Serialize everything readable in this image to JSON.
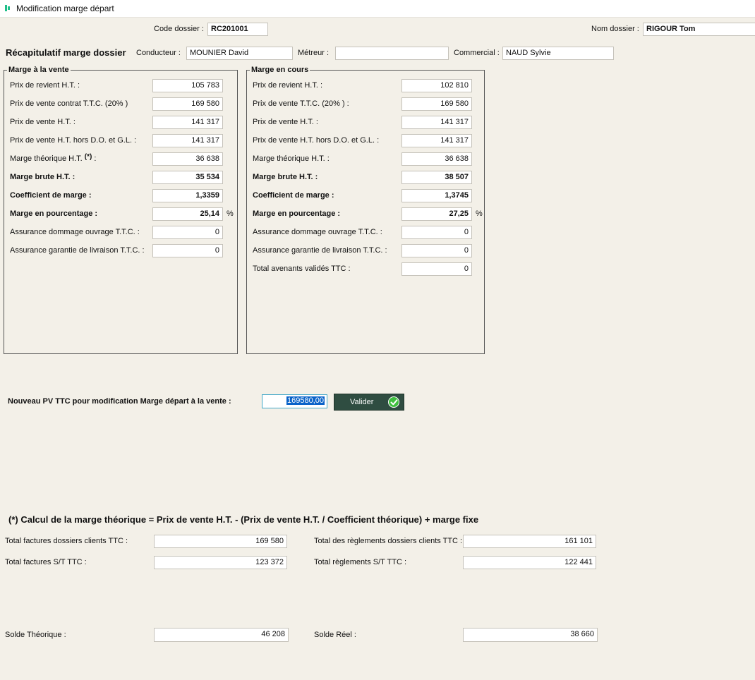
{
  "window": {
    "title": "Modification marge départ"
  },
  "header": {
    "code_label": "Code dossier :",
    "code_value": "RC201001",
    "nom_label": "Nom dossier :",
    "nom_value": "RIGOUR Tom"
  },
  "recap": {
    "title": "Récapitulatif marge dossier",
    "conducteur_label": "Conducteur :",
    "conducteur_value": "MOUNIER David",
    "metreur_label": "Métreur :",
    "metreur_value": "",
    "commercial_label": "Commercial :",
    "commercial_value": "NAUD Sylvie"
  },
  "vente": {
    "title": "Marge à la vente",
    "rows": [
      {
        "label": "Prix de revient H.T. :",
        "value": "105 783",
        "bold": false
      },
      {
        "label": "Prix de vente contrat T.T.C. (20% )",
        "value": "169 580",
        "bold": false
      },
      {
        "label": "Prix de vente H.T. :",
        "value": "141 317",
        "bold": false
      },
      {
        "label": "Prix de vente H.T. hors D.O. et G.L. :",
        "value": "141 317",
        "bold": false
      },
      {
        "label": "Marge théorique H.T.",
        "suffix": "(*)",
        "tail": " :",
        "value": "36 638",
        "bold": false
      },
      {
        "label": "Marge brute H.T. :",
        "value": "35 534",
        "bold": true
      },
      {
        "label": "Coefficient de marge  :",
        "value": "1,3359",
        "bold": true
      },
      {
        "label": "Marge en pourcentage :",
        "value": "25,14",
        "bold": true,
        "unit": "%"
      },
      {
        "label": "Assurance dommage ouvrage  T.T.C. :",
        "value": "0",
        "bold": false
      },
      {
        "label": "Assurance garantie de livraison T.T.C. :",
        "value": "0",
        "bold": false
      }
    ]
  },
  "cours": {
    "title": "Marge en cours",
    "rows": [
      {
        "label": "Prix de revient H.T. :",
        "value": "102 810",
        "bold": false
      },
      {
        "label": "Prix de vente T.T.C.    (20% )          :",
        "value": "169 580",
        "bold": false
      },
      {
        "label": "Prix de vente H.T. :",
        "value": "141 317",
        "bold": false
      },
      {
        "label": "Prix de vente H.T. hors D.O. et G.L. :",
        "value": "141 317",
        "bold": false
      },
      {
        "label": "Marge théorique H.T.        :",
        "value": "36 638",
        "bold": false
      },
      {
        "label": "Marge brute H.T. :",
        "value": "38 507",
        "bold": true
      },
      {
        "label": "Coefficient de marge  :",
        "value": "1,3745",
        "bold": true
      },
      {
        "label": "Marge en pourcentage :",
        "value": "27,25",
        "bold": true,
        "unit": "%"
      },
      {
        "label": "Assurance dommage ouvrage  T.T.C. :",
        "value": "0",
        "bold": false
      },
      {
        "label": "Assurance garantie de livraison T.T.C. :",
        "value": "0",
        "bold": false
      },
      {
        "label": "Total avenants validés TTC  :",
        "value": "0",
        "bold": false
      }
    ]
  },
  "nouveau": {
    "label": "Nouveau PV TTC pour modification Marge départ à la vente :",
    "value": "169580,00",
    "button_label": "Valider"
  },
  "note": {
    "star": "(*)",
    "text": " Calcul de la marge théorique = Prix de vente H.T. - (Prix de vente H.T. / Coefficient théorique) + marge fixe"
  },
  "totals": {
    "fact_clients_label": "Total factures dossiers clients TTC :",
    "fact_clients_value": "169 580",
    "fact_st_label": "Total factures S/T TTC :",
    "fact_st_value": "123 372",
    "regl_clients_label": "Total des règlements dossiers clients TTC :",
    "regl_clients_value": "161 101",
    "regl_st_label": "Total règlements S/T TTC :",
    "regl_st_value": "122 441",
    "solde_theo_label": "Solde Théorique :",
    "solde_theo_value": "46 208",
    "solde_reel_label": "Solde Réel :",
    "solde_reel_value": "38 660"
  }
}
